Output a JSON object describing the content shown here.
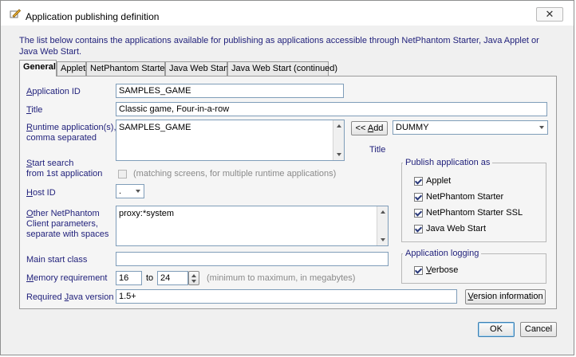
{
  "window": {
    "title": "Application publishing definition",
    "close_glyph": "✕"
  },
  "intro": "The list below contains the applications available for publishing as applications accessible through NetPhantom Starter, Java Applet or Java Web Start.",
  "tabs": [
    {
      "label": "General",
      "active": true
    },
    {
      "label": "Applet"
    },
    {
      "label": "NetPhantom Starter"
    },
    {
      "label": "Java Web Start"
    },
    {
      "label": "Java Web Start (continued)"
    }
  ],
  "form": {
    "app_id": {
      "label_u": "A",
      "label_rest": "pplication ID",
      "value": "SAMPLES_GAME"
    },
    "title": {
      "label_u": "T",
      "label_rest": "itle",
      "value": "Classic game, Four-in-a-row"
    },
    "runtime": {
      "label_u": "R",
      "label_rest": "untime application(s),",
      "label_line2": "comma separated",
      "value": "SAMPLES_GAME"
    },
    "add_button": {
      "pre": "<< ",
      "u": "A",
      "rest": "dd"
    },
    "runtime_combo": {
      "value": "DUMMY"
    },
    "title_caption": "Title",
    "start_search": {
      "line1_u": "S",
      "line1_rest": "tart search",
      "line2": "from 1st application",
      "hint": "(matching screens, for multiple runtime applications)"
    },
    "host_id": {
      "label_u": "H",
      "label_rest": "ost ID",
      "value": "."
    },
    "other_params": {
      "label_u": "O",
      "label_rest": "ther NetPhantom",
      "label_line2": "Client parameters,",
      "label_line3": "separate with spaces",
      "value": "proxy:*system"
    },
    "main_class": {
      "label": "Main start class",
      "value": ""
    },
    "memory": {
      "label_u": "M",
      "label_rest": "emory requirement",
      "min": "16",
      "to": "to",
      "max": "24",
      "hint": "(minimum to maximum, in megabytes)"
    },
    "java_version": {
      "label_pre": "Required ",
      "label_u": "J",
      "label_rest": "ava version",
      "value": "1.5+"
    },
    "version_button": {
      "u": "V",
      "rest": "ersion information"
    }
  },
  "publish_group": {
    "legend": "Publish application as",
    "options": [
      {
        "label": "Applet",
        "checked": true
      },
      {
        "label": "NetPhantom Starter",
        "checked": true
      },
      {
        "label": "NetPhantom Starter SSL",
        "checked": true
      },
      {
        "label": "Java Web Start",
        "checked": true
      }
    ]
  },
  "logging_group": {
    "legend": "Application logging",
    "verbose": {
      "u": "V",
      "rest": "erbose",
      "checked": true
    }
  },
  "buttons": {
    "ok": "OK",
    "cancel": "Cancel"
  },
  "colors": {
    "label_blue": "#1f1f7a",
    "field_border": "#7f9db9",
    "panel_bg": "#f5f5f5"
  }
}
